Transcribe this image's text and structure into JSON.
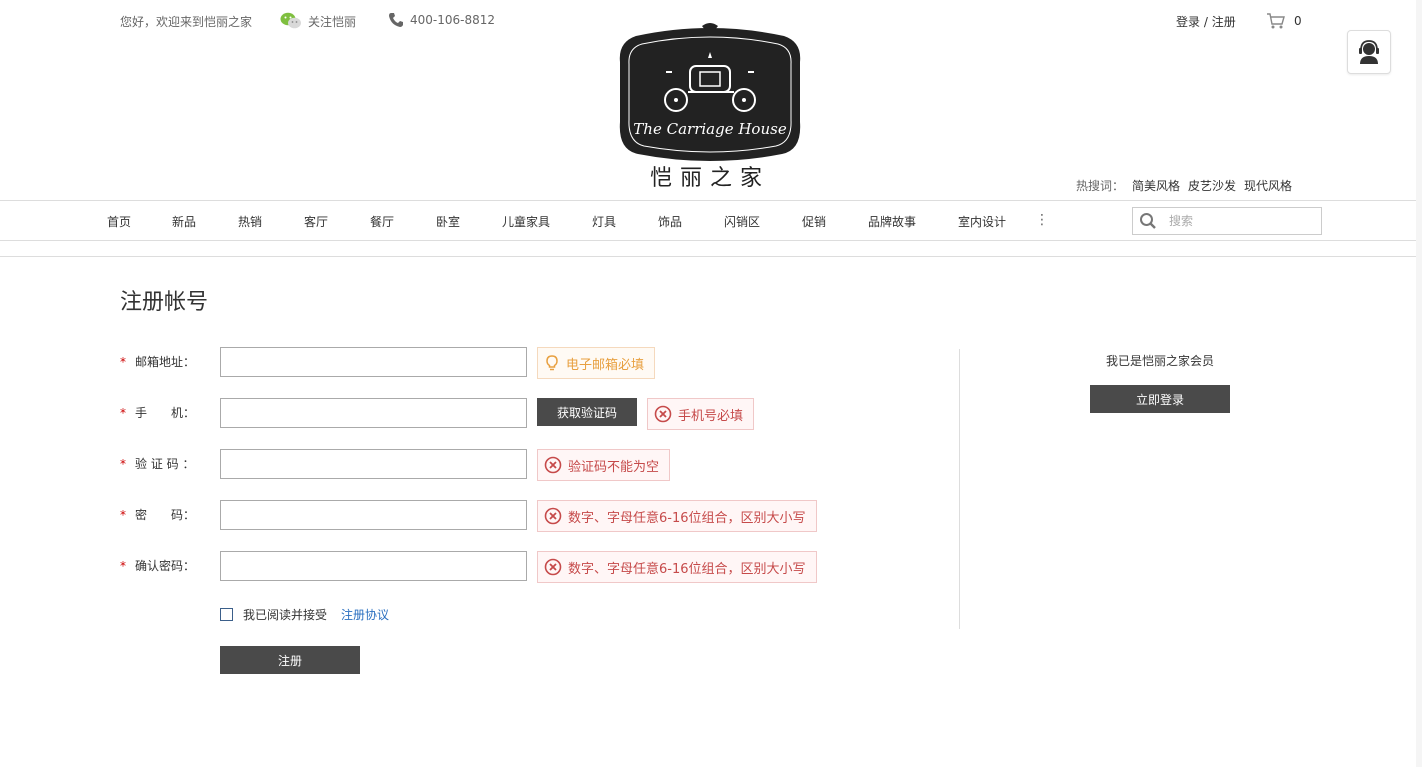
{
  "topbar": {
    "welcome": "您好，欢迎来到恺丽之家",
    "wechat_label": "关注恺丽",
    "phone": "400-106-8812",
    "login": "登录",
    "separator": " / ",
    "register": "注册",
    "cart_count": "0"
  },
  "logo": {
    "en": "The Carriage House",
    "cn": "恺丽之家"
  },
  "hot": {
    "label": "热搜词：",
    "terms": [
      "简美风格",
      "皮艺沙发",
      "现代风格"
    ]
  },
  "nav": {
    "items": [
      "首页",
      "新品",
      "热销",
      "客厅",
      "餐厅",
      "卧室",
      "儿童家具",
      "灯具",
      "饰品",
      "闪销区",
      "促销",
      "品牌故事",
      "室内设计"
    ],
    "more": "⋮",
    "search_placeholder": "搜索"
  },
  "form": {
    "title": "注册帐号",
    "fields": [
      {
        "label": "邮箱地址：",
        "value": "",
        "msg": "电子邮箱必填",
        "msg_type": "warn"
      },
      {
        "label": "手　　机：",
        "value": "",
        "msg": "手机号必填",
        "msg_type": "err"
      },
      {
        "label": "验 证 码 ：",
        "value": "",
        "msg": "验证码不能为空",
        "msg_type": "err"
      },
      {
        "label": "密　　码：",
        "value": "",
        "msg": "数字、字母任意6-16位组合，区别大小写",
        "msg_type": "err"
      },
      {
        "label": "确认密码：",
        "value": "",
        "msg": "数字、字母任意6-16位组合，区别大小写",
        "msg_type": "err"
      }
    ],
    "required_mark": "*",
    "code_button": "获取验证码",
    "agree_text": "我已阅读并接受",
    "agree_link": "注册协议",
    "submit": "注册"
  },
  "aside": {
    "member_text": "我已是恺丽之家会员",
    "login_button": "立即登录"
  },
  "colors": {
    "dark_button": "#4a4a4a",
    "warn": "#e8a040",
    "error": "#c64a4a",
    "link": "#2a6fc0"
  }
}
